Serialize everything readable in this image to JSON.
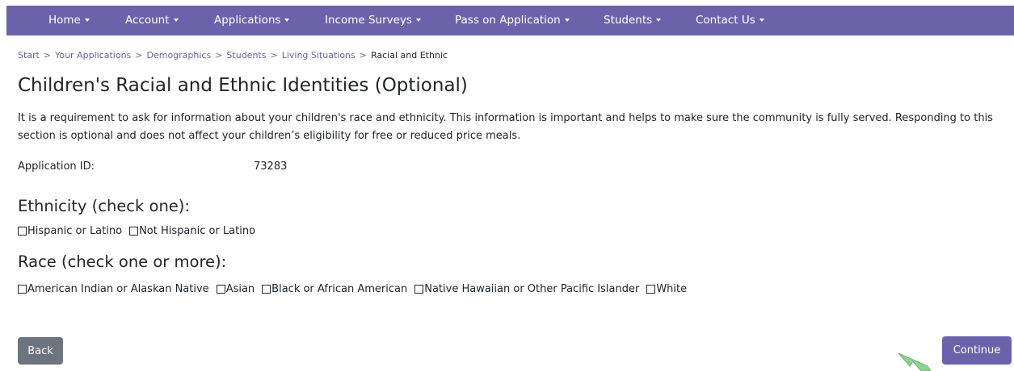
{
  "nav": {
    "items": [
      {
        "label": "Home"
      },
      {
        "label": "Account"
      },
      {
        "label": "Applications"
      },
      {
        "label": "Income Surveys"
      },
      {
        "label": "Pass on Application"
      },
      {
        "label": "Students"
      },
      {
        "label": "Contact Us"
      }
    ]
  },
  "breadcrumb": {
    "items": [
      "Start",
      "Your Applications",
      "Demographics",
      "Students",
      "Living Situations"
    ],
    "separator": ">",
    "current": "Racial and Ethnic"
  },
  "page": {
    "title": "Children's Racial and Ethnic Identities (Optional)",
    "intro": "It is a requirement to ask for information about your children's race and ethnicity. This information is important and helps to make sure the community is fully served. Responding to this section is optional and does not affect your children’s eligibility for free or reduced price meals."
  },
  "application": {
    "id_label": "Application ID:",
    "id_value": "73283"
  },
  "ethnicity": {
    "heading": "Ethnicity (check one):",
    "options": [
      "Hispanic or Latino",
      "Not Hispanic or Latino"
    ]
  },
  "race": {
    "heading": "Race (check one or more):",
    "options": [
      "American Indian or Alaskan Native",
      "Asian",
      "Black or African American",
      "Native Hawaiian or Other Pacific Islander",
      "White"
    ]
  },
  "buttons": {
    "back": "Back",
    "continue": "Continue"
  },
  "colors": {
    "brand": "#6c62ab",
    "secondary": "#6c757d",
    "cursor": "#8fd18f"
  }
}
